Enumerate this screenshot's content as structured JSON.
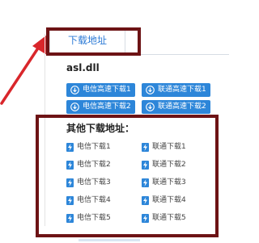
{
  "tab": {
    "label": "下载地址"
  },
  "file": {
    "name": "asl.dll"
  },
  "buttons": [
    {
      "label": "电信高速下载1"
    },
    {
      "label": "联通高速下载1"
    },
    {
      "label": "电信高速下载2"
    },
    {
      "label": "联通高速下载2"
    }
  ],
  "other": {
    "title": "其他下载地址：",
    "links": [
      {
        "label": "电信下载1"
      },
      {
        "label": "联通下载1"
      },
      {
        "label": "电信下载2"
      },
      {
        "label": "联通下载2"
      },
      {
        "label": "电信下载3"
      },
      {
        "label": "联通下载3"
      },
      {
        "label": "电信下载4"
      },
      {
        "label": "联通下载4"
      },
      {
        "label": "电信下载5"
      },
      {
        "label": "联通下载5"
      }
    ]
  },
  "icons": {
    "download": "download-circle-icon",
    "link": "lightning-bolt-icon",
    "annotation": "red-arrow-icon"
  },
  "colors": {
    "accent": "#2d86d9",
    "highlight_box": "#6d1315",
    "arrow": "#d9262b"
  }
}
